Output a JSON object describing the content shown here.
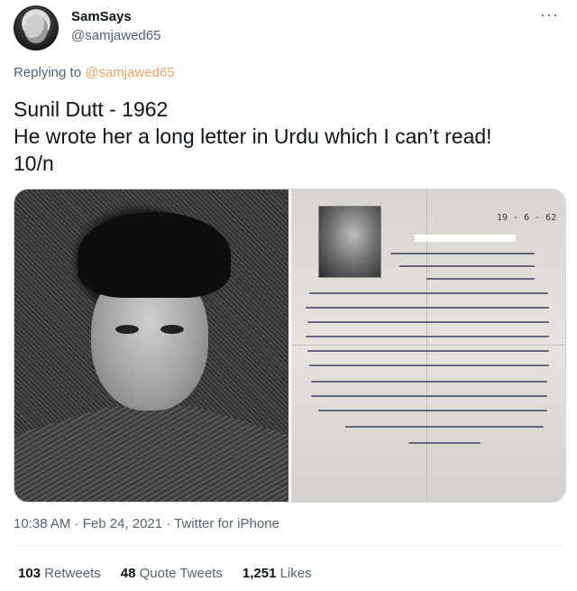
{
  "author": {
    "name": "SamSays",
    "handle": "@samjawed65"
  },
  "reply": {
    "prefix": "Replying to",
    "to": "@samjawed65"
  },
  "tweet": {
    "lines": [
      "Sunil Dutt - 1962",
      "He wrote her a long letter in Urdu which I can’t read!",
      "10/n"
    ]
  },
  "media": {
    "items": [
      "portrait-photo",
      "urdu-letter-photo"
    ],
    "letter_date": "19 - 6 - 62"
  },
  "meta": {
    "timestamp": "10:38 AM · Feb 24, 2021 · Twitter for iPhone"
  },
  "stats": {
    "retweets_count": "103",
    "retweets_label": "Retweets",
    "quotes_count": "48",
    "quotes_label": "Quote Tweets",
    "likes_count": "1,251",
    "likes_label": "Likes"
  },
  "icons": {
    "more": "more-dots-icon"
  }
}
